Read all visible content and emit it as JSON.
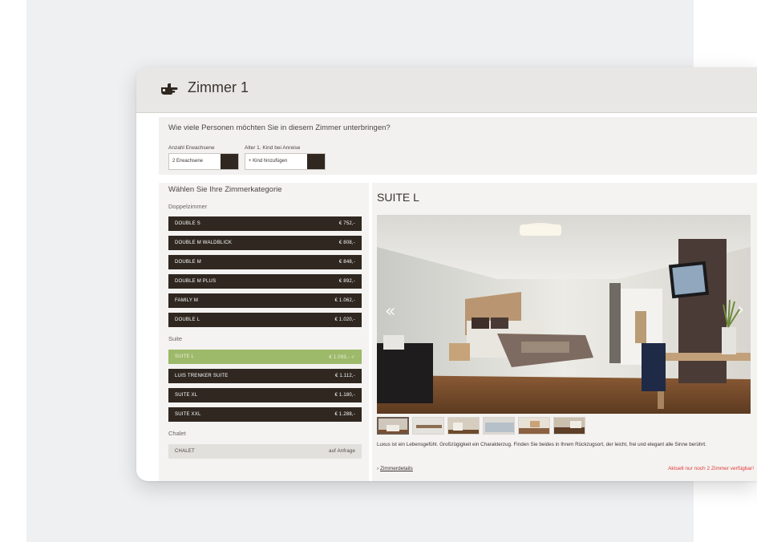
{
  "header": {
    "title": "Zimmer 1",
    "icon": "hand-pointing-icon"
  },
  "persons": {
    "question": "Wie viele Personen möchten Sie in diesem Zimmer unterbringen?",
    "adults_label": "Anzahl Erwachsene",
    "adults_value": "2 Erwachsene",
    "child_label": "Alter 1. Kind bei Anreise",
    "child_value": "+ Kind hinzufügen"
  },
  "categories": {
    "title": "Wählen Sie Ihre Zimmerkategorie",
    "groups": [
      {
        "label": "Doppelzimmer",
        "items": [
          {
            "name": "DOUBLE S",
            "price": "€ 752,-"
          },
          {
            "name": "DOUBLE M WALDBLICK",
            "price": "€ 808,-"
          },
          {
            "name": "DOUBLE M",
            "price": "€ 848,-"
          },
          {
            "name": "DOUBLE M PLUS",
            "price": "€ 892,-"
          },
          {
            "name": "FAMILY M",
            "price": "€ 1.062,-"
          },
          {
            "name": "DOUBLE L",
            "price": "€ 1.020,-"
          }
        ]
      },
      {
        "label": "Suite",
        "items": [
          {
            "name": "SUITE L",
            "price": "€ 1.093,- ✓",
            "selected": true
          },
          {
            "name": "LUIS TRENKER SUITE",
            "price": "€ 1.112,-"
          },
          {
            "name": "SUITE XL",
            "price": "€ 1.180,-"
          },
          {
            "name": "SUITE XXL",
            "price": "€ 1.288,-"
          }
        ]
      },
      {
        "label": "Chalet",
        "items": [
          {
            "name": "CHALET",
            "price": "auf Anfrage"
          }
        ]
      }
    ]
  },
  "detail": {
    "title": "SUITE L",
    "prev_icon": "double-chevron-left-icon",
    "next_icon": "chevron-right-icon",
    "thumb_count": 6,
    "description": "Luxus ist ein Lebensgefühl. Großzügigkeit ein Charakterzug. Finden Sie beides in Ihrem Rückzugsort, der leicht, frei und elegant alle Sinne berührt.",
    "details_prefix": "›",
    "details_link": "Zimmerdetails",
    "availability": "Aktuell nur noch 2 Zimmer verfügbar!"
  },
  "colors": {
    "row_dark": "#2f2720",
    "row_selected": "#9db96a",
    "availability": "#e03b3b",
    "header_bg": "#e8e7e5"
  }
}
